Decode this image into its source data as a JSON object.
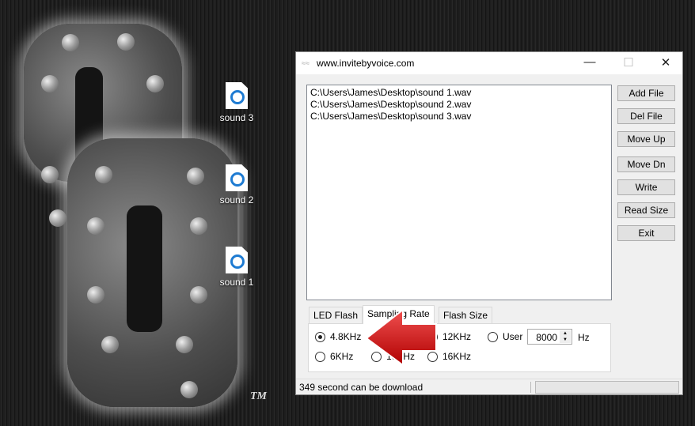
{
  "desktop": {
    "icons": [
      {
        "label": "sound 3"
      },
      {
        "label": "sound 2"
      },
      {
        "label": "sound 1"
      }
    ],
    "trademark": "TM"
  },
  "window": {
    "title": "www.invitebyvoice.com",
    "files": [
      "C:\\Users\\James\\Desktop\\sound 1.wav",
      "C:\\Users\\James\\Desktop\\sound 2.wav",
      "C:\\Users\\James\\Desktop\\sound 3.wav"
    ],
    "buttons": {
      "add": "Add File",
      "del": "Del File",
      "up": "Move Up",
      "down": "Move Dn",
      "write": "Write",
      "read": "Read Size",
      "exit": "Exit"
    },
    "tabs": [
      "LED Flash",
      "Sampling Rate",
      "Flash Size"
    ],
    "rates": {
      "r48": "4.8KHz",
      "r12": "12KHz",
      "user": "User",
      "r6": "6KHz",
      "r10": "10KHz",
      "r16": "16KHz",
      "selected": "4.8KHz"
    },
    "user_value": "8000",
    "unit": "Hz",
    "status": "349 second can be download",
    "progress": 0
  },
  "arrow_color": "#d41010"
}
